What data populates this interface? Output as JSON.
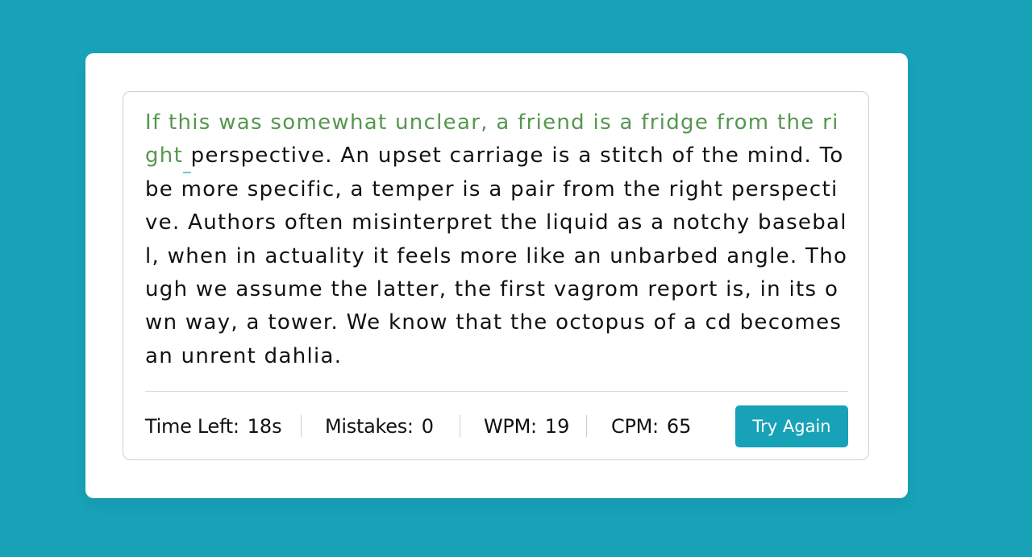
{
  "typing": {
    "typed_text": "If this was somewhat unclear, a friend is a fridge from the right ",
    "remaining_text": "perspective. An upset carriage is a stitch of the mind. To be more specific, a temper is a pair from the right perspective. Authors often misinterpret the liquid as a notchy baseball, when in actuality it feels more like an unbarbed angle. Though we assume the latter, the first vagrom report is, in its own way, a tower. We know that the octopus of a cd becomes an unrent dahlia."
  },
  "stats": {
    "time_left_label": "Time Left:",
    "time_left_value": "18s",
    "mistakes_label": "Mistakes:",
    "mistakes_value": "0",
    "wpm_label": "WPM:",
    "wpm_value": "19",
    "cpm_label": "CPM:",
    "cpm_value": "65"
  },
  "button": {
    "try_again_label": "Try Again"
  },
  "colors": {
    "background": "#17a2b8",
    "correct_text": "#56964f",
    "text": "#111111",
    "button": "#17a2b8"
  }
}
